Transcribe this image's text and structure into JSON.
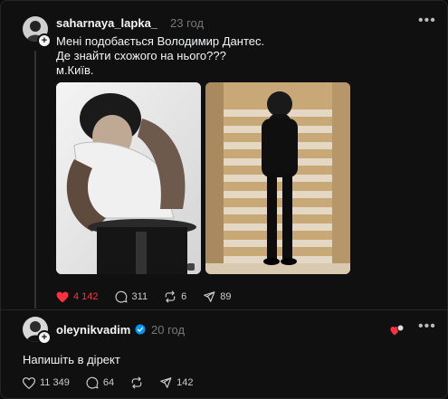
{
  "post1": {
    "username": "saharnaya_lapka_",
    "time": "23 год",
    "text_lines": [
      "Мені подобається Володимир Дантес.",
      "Де знайти схожого на нього???",
      "м.Київ."
    ],
    "likes": "4 142",
    "comments": "311",
    "reposts": "6",
    "shares": "89"
  },
  "post2": {
    "username": "oleynikvadim",
    "time": "20 год",
    "text": "Напишіть в дірект",
    "likes": "11 349",
    "comments": "64",
    "shares": "142"
  },
  "icons": {
    "more": "more-dots-icon",
    "heart": "heart-icon",
    "comment": "comment-icon",
    "repost": "repost-icon",
    "share": "share-icon",
    "verified": "verified-badge-icon"
  },
  "colors": {
    "background": "#101010",
    "liked": "#ff3040",
    "verified": "#0095f6"
  }
}
